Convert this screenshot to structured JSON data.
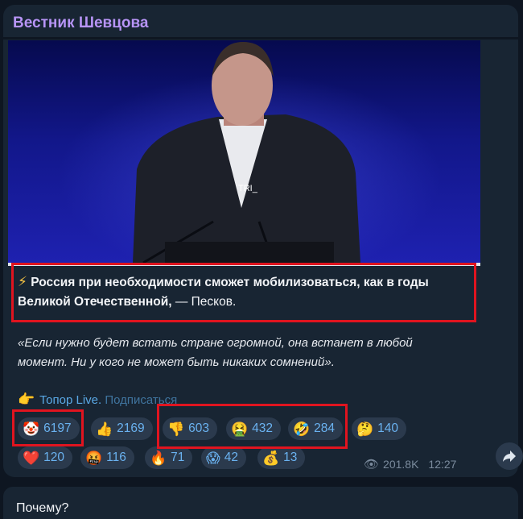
{
  "channel": {
    "name": "Вестник Шевцова"
  },
  "photo": {
    "watermark": "TRI_",
    "video_progress": 1.0
  },
  "message": {
    "bolt": "⚡",
    "headline_bold": "Россия при необходимости сможет мобилизоваться, как в годы Великой Отечественной,",
    "headline_rest": " — Песков.",
    "quote": "«Если нужно будет встать стране огромной, она встанет в любой момент. Ни у кого не может быть никаких сомнений».",
    "promo_icon": "pointing-hand-icon",
    "promo_hand": "👉",
    "promo_name": "Топор Live.",
    "promo_action": "Подписаться"
  },
  "reactions": [
    {
      "emoji": "🤡",
      "icon": "clown-face-icon",
      "count": "6197"
    },
    {
      "emoji": "👍",
      "icon": "thumbs-up-icon",
      "count": "2169"
    },
    {
      "emoji": "👎",
      "icon": "thumbs-down-icon",
      "count": "603"
    },
    {
      "emoji": "🤮",
      "icon": "vomiting-face-icon",
      "count": "432"
    },
    {
      "emoji": "🤣",
      "icon": "rofl-face-icon",
      "count": "284"
    },
    {
      "emoji": "🤔",
      "icon": "thinking-face-icon",
      "count": "140"
    },
    {
      "emoji": "❤️",
      "icon": "red-heart-icon",
      "count": "120"
    },
    {
      "emoji": "🤬",
      "icon": "cursing-face-icon",
      "count": "116"
    },
    {
      "emoji": "🔥",
      "icon": "fire-icon",
      "count": "71"
    },
    {
      "emoji": "😱",
      "icon": "screaming-face-icon",
      "count": "42"
    },
    {
      "emoji": "💰",
      "icon": "money-bag-icon",
      "count": "13"
    }
  ],
  "meta": {
    "views": "201.8K",
    "time": "12:27",
    "views_icon": "eye-icon"
  },
  "share": {
    "icon": "share-arrow-icon"
  },
  "next_message": {
    "text": "Почему?"
  },
  "colors": {
    "accent": "#6ab2f0",
    "channel_name": "#b794f6",
    "highlight": "#e0141f"
  }
}
